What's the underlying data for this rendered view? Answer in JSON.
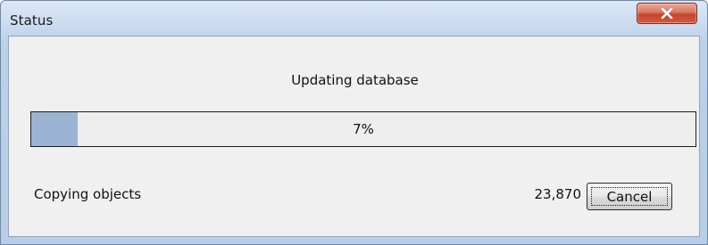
{
  "window": {
    "title": "Status"
  },
  "titlebar": {
    "close_icon": "close-icon"
  },
  "main": {
    "heading": "Updating database",
    "progress": {
      "fraction": 0.07,
      "label": "7%",
      "fill_color": "#9bb4d3"
    },
    "status_text": "Copying objects",
    "count_text": "23,870",
    "cancel_label": "Cancel"
  }
}
